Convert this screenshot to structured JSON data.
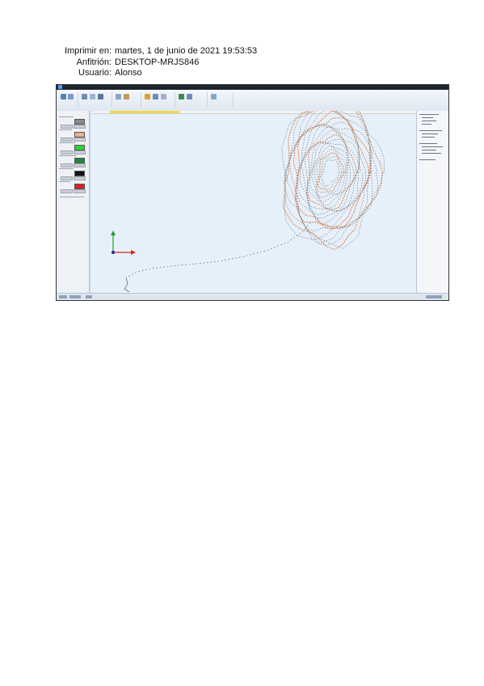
{
  "print_header": {
    "printed_label": "Imprimir en:",
    "printed_value": "martes, 1 de junio de 2021 19:53:53",
    "host_label": "Anfitrión:",
    "host_value": "DESKTOP-MRJS846",
    "user_label": "Usuario:",
    "user_value": "Alonso"
  },
  "screenshot": {
    "colors": {
      "viewport_bg": "#e6f0fa",
      "contour_dark": "#4a3f38",
      "contour_orange": "#d9773a",
      "axis_x": "#e02020",
      "axis_y": "#1aa01a",
      "axis_origin": "#1e2a8c"
    },
    "layer_swatches": [
      "#8a8a8a",
      "#e8b090",
      "#2ed43a",
      "#1f8a3a",
      "#111111",
      "#e02020"
    ],
    "icons": [
      "app-icon",
      "axis-triad-icon"
    ]
  }
}
